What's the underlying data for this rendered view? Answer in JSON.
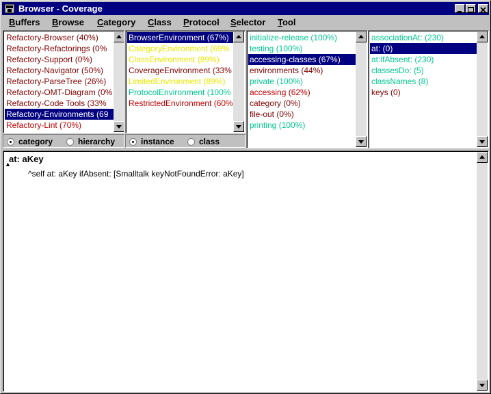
{
  "window": {
    "title": "Browser - Coverage",
    "controls": [
      "minimize-icon",
      "maximize-icon",
      "close-icon"
    ]
  },
  "menu": [
    "Buffers",
    "Browse",
    "Category",
    "Class",
    "Protocol",
    "Selector",
    "Tool"
  ],
  "categories": {
    "items": [
      {
        "label": "Refactory-Browser (40%)",
        "color": "#800000"
      },
      {
        "label": "Refactory-Refactorings (0%",
        "color": "#800000"
      },
      {
        "label": "Refactory-Support (0%)",
        "color": "#800000"
      },
      {
        "label": "Refactory-Navigator (50%)",
        "color": "#800000"
      },
      {
        "label": "Refactory-ParseTree (26%)",
        "color": "#800000"
      },
      {
        "label": "Refactory-OMT-Diagram (0%",
        "color": "#800000"
      },
      {
        "label": "Refactory-Code Tools (33%",
        "color": "#800000"
      },
      {
        "label": "Refactory-Environments (69",
        "color": "#ffffff",
        "selected": true
      },
      {
        "label": "Refactory-Lint (70%)",
        "color": "#c00000"
      }
    ]
  },
  "classes": {
    "items": [
      {
        "label": "BrowserEnvironment (67%)",
        "color": "#ffffff",
        "selected": true
      },
      {
        "label": "CategoryEnvironment (69%",
        "color": "#e8e800"
      },
      {
        "label": "ClassEnvironment (89%)",
        "color": "#e8e800"
      },
      {
        "label": "CoverageEnvironment (33%",
        "color": "#800000"
      },
      {
        "label": "LimitedEnvironment (89%)",
        "color": "#e8e800"
      },
      {
        "label": "ProtocolEnvironment (100%",
        "color": "#00c890"
      },
      {
        "label": "RestrictedEnvironment (60%",
        "color": "#c00000"
      }
    ]
  },
  "protocols": {
    "items": [
      {
        "label": "initialize-release (100%)",
        "color": "#00c890"
      },
      {
        "label": "testing (100%)",
        "color": "#00c890"
      },
      {
        "label": "accessing-classes (67%)",
        "color": "#ffffff",
        "selected": true
      },
      {
        "label": "environments (44%)",
        "color": "#800000"
      },
      {
        "label": "private (100%)",
        "color": "#00c890"
      },
      {
        "label": "accessing (62%)",
        "color": "#c00000"
      },
      {
        "label": "category (0%)",
        "color": "#800000"
      },
      {
        "label": "file-out (0%)",
        "color": "#800000"
      },
      {
        "label": "printing (100%)",
        "color": "#00c890"
      }
    ]
  },
  "selectors": {
    "items": [
      {
        "label": "associationAt: (230)",
        "color": "#00c890"
      },
      {
        "label": "at: (0)",
        "color": "#ffffff",
        "selected": true
      },
      {
        "label": "at:ifAbsent: (230)",
        "color": "#00c890"
      },
      {
        "label": "classesDo: (5)",
        "color": "#00c890"
      },
      {
        "label": "classNames (8)",
        "color": "#00c890"
      },
      {
        "label": "keys (0)",
        "color": "#800000"
      }
    ]
  },
  "category_mode": {
    "options": [
      "category",
      "hierarchy"
    ],
    "selected": "category"
  },
  "class_mode": {
    "options": [
      "instance",
      "class"
    ],
    "selected": "instance"
  },
  "code": {
    "signature": "at: aKey",
    "body": "^self at: aKey ifAbsent: [Smalltalk keyNotFoundError: aKey]"
  }
}
